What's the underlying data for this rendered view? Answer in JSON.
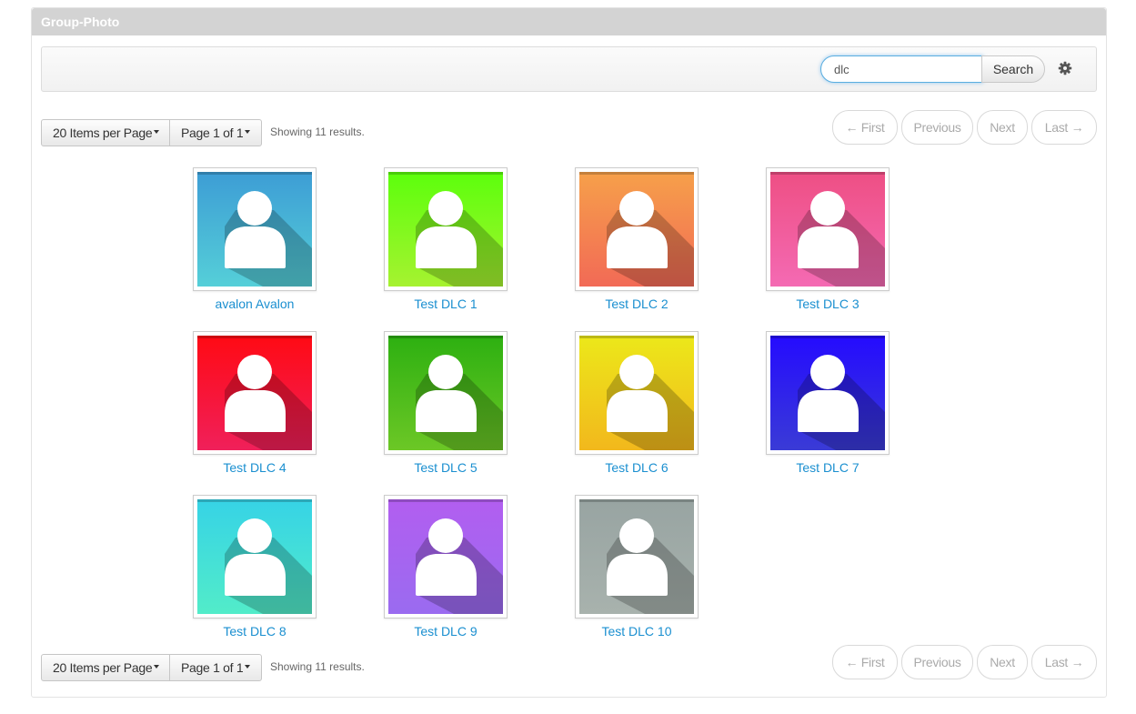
{
  "portlet": {
    "title": "Group-Photo"
  },
  "search": {
    "value": "dlc",
    "button_label": "Search",
    "settings_icon": "gear-icon"
  },
  "pagination": {
    "items_per_page_label": "20 Items per Page",
    "page_label": "Page 1 of 1",
    "results_text": "Showing 11 results.",
    "first_label": "← First",
    "previous_label": "Previous",
    "next_label": "Next",
    "last_label": "Last →"
  },
  "entries": [
    {
      "name": "avalon Avalon",
      "icon": "user-icon",
      "color_top": "#3d9dd5",
      "color_bottom": "#55cfd8"
    },
    {
      "name": "Test DLC 1",
      "icon": "user-icon",
      "color_top": "#5cff0c",
      "color_bottom": "#a6f230"
    },
    {
      "name": "Test DLC 2",
      "icon": "user-icon",
      "color_top": "#f6a04a",
      "color_bottom": "#f26a56"
    },
    {
      "name": "Test DLC 3",
      "icon": "user-icon",
      "color_top": "#ee4f84",
      "color_bottom": "#f46ab3"
    },
    {
      "name": "Test DLC 4",
      "icon": "user-icon",
      "color_top": "#ff0a14",
      "color_bottom": "#f0205a"
    },
    {
      "name": "Test DLC 5",
      "icon": "user-icon",
      "color_top": "#2db011",
      "color_bottom": "#6cc726"
    },
    {
      "name": "Test DLC 6",
      "icon": "user-icon",
      "color_top": "#ece81a",
      "color_bottom": "#f2b81c"
    },
    {
      "name": "Test DLC 7",
      "icon": "user-icon",
      "color_top": "#250bff",
      "color_bottom": "#3a3bd6"
    },
    {
      "name": "Test DLC 8",
      "icon": "user-icon",
      "color_top": "#36d3e6",
      "color_bottom": "#52ecc9"
    },
    {
      "name": "Test DLC 9",
      "icon": "user-icon",
      "color_top": "#b25ef0",
      "color_bottom": "#9a6bf0"
    },
    {
      "name": "Test DLC 10",
      "icon": "user-icon",
      "color_top": "#98a4a2",
      "color_bottom": "#a8b2ad"
    }
  ]
}
